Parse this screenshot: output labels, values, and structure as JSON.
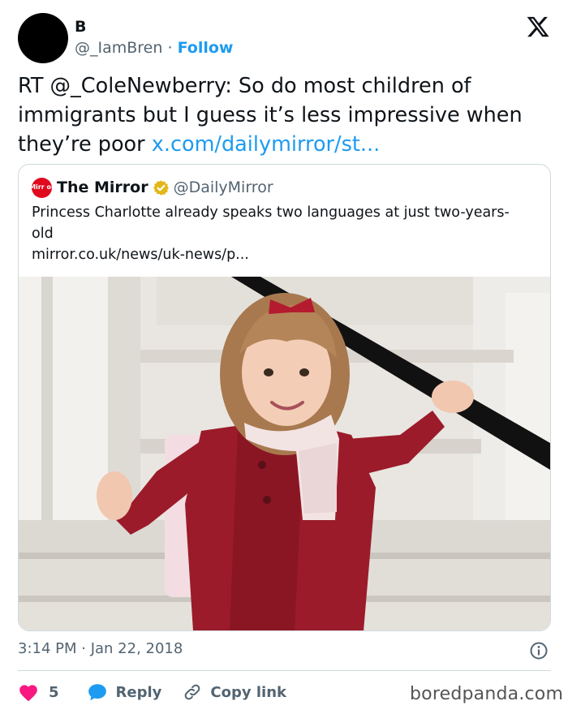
{
  "author": {
    "name": "B",
    "handle": "@_IamBren",
    "separator": "·",
    "follow_label": "Follow"
  },
  "tweet": {
    "text": "RT @_ColeNewberry: So do most children of immigrants but I guess it’s less impressive when they’re poor",
    "link_text": "x.com/dailymirror/st..."
  },
  "quoted": {
    "logo_text": "Mirr or",
    "name": "The Mirror",
    "handle": "@DailyMirror",
    "text": "Princess Charlotte already speaks two languages at just two-years-old",
    "url": "mirror.co.uk/news/uk-news/p..."
  },
  "meta": {
    "timestamp": "3:14 PM · Jan 22, 2018"
  },
  "actions": {
    "like_count": "5",
    "reply_label": "Reply",
    "copy_label": "Copy link"
  },
  "watermark": "boredpanda.com",
  "colors": {
    "accent": "#1d9bf0",
    "like": "#f91880",
    "mirror_red": "#e00a1f",
    "verified_gold": "#e2b719"
  },
  "icons": [
    "x-logo-icon",
    "verified-badge-icon",
    "info-icon",
    "heart-icon",
    "reply-bubble-icon",
    "link-icon"
  ]
}
